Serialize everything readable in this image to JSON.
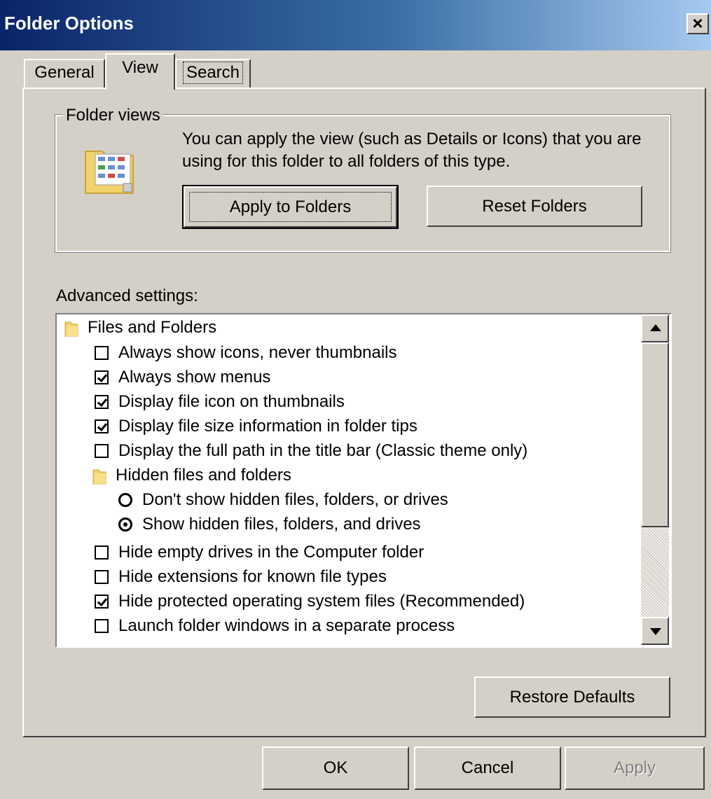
{
  "window": {
    "title": "Folder Options",
    "close_label": "×"
  },
  "tabs": [
    {
      "label": "General"
    },
    {
      "label": "View"
    },
    {
      "label": "Search"
    }
  ],
  "folder_views": {
    "legend": "Folder views",
    "description": "You can apply the view (such as Details or Icons) that you are using for this folder to all folders of this type.",
    "apply_to_folders_label": "Apply to Folders",
    "reset_folders_label": "Reset Folders"
  },
  "advanced": {
    "label": "Advanced settings:",
    "items": [
      {
        "kind": "folder",
        "label": "Files and Folders"
      },
      {
        "kind": "checkbox",
        "checked": false,
        "label": "Always show icons, never thumbnails"
      },
      {
        "kind": "checkbox",
        "checked": true,
        "label": "Always show menus"
      },
      {
        "kind": "checkbox",
        "checked": true,
        "label": "Display file icon on thumbnails"
      },
      {
        "kind": "checkbox",
        "checked": true,
        "label": "Display file size information in folder tips"
      },
      {
        "kind": "checkbox",
        "checked": false,
        "label": "Display the full path in the title bar (Classic theme only)"
      },
      {
        "kind": "folder",
        "label": "Hidden files and folders"
      },
      {
        "kind": "radio",
        "checked": false,
        "label": "Don't show hidden files, folders, or drives"
      },
      {
        "kind": "radio",
        "checked": true,
        "label": "Show hidden files, folders, and drives"
      },
      {
        "kind": "checkbox",
        "checked": false,
        "label": "Hide empty drives in the Computer folder"
      },
      {
        "kind": "checkbox",
        "checked": false,
        "label": "Hide extensions for known file types"
      },
      {
        "kind": "checkbox",
        "checked": true,
        "label": "Hide protected operating system files (Recommended)"
      },
      {
        "kind": "checkbox",
        "checked": false,
        "label": "Launch folder windows in a separate process"
      }
    ]
  },
  "restore_defaults_label": "Restore Defaults",
  "footer": {
    "ok_label": "OK",
    "cancel_label": "Cancel",
    "apply_label": "Apply"
  },
  "colors": {
    "title_start": "#0a246a",
    "title_end": "#a6caf0",
    "face": "#d4d0c8"
  }
}
